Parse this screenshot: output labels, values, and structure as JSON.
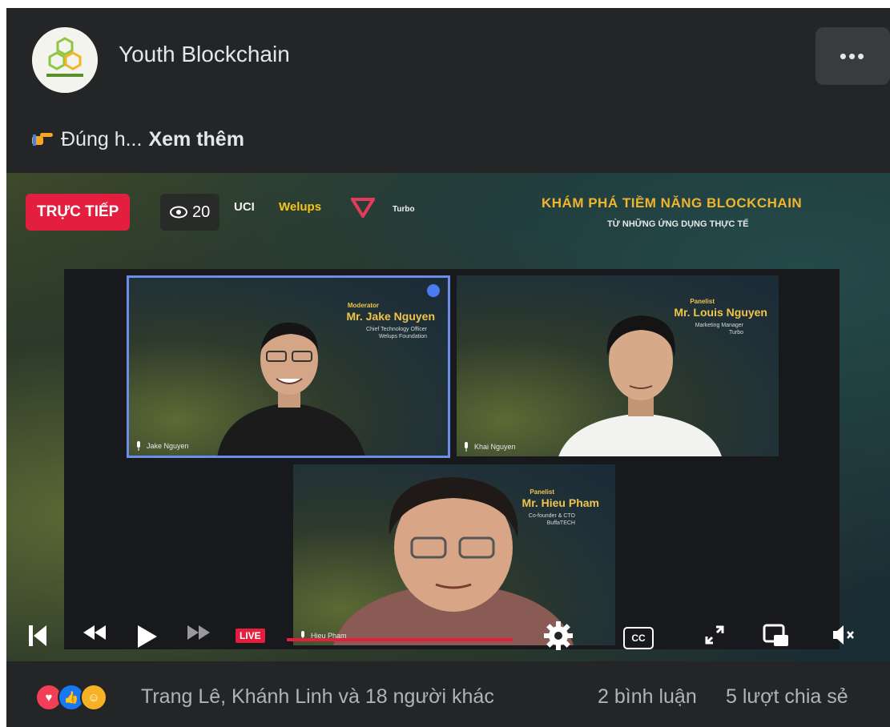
{
  "post": {
    "page_name": "Youth Blockchain",
    "more_label": "•••",
    "caption_text": "Đúng h...",
    "caption_more": "Xem thêm"
  },
  "video": {
    "live_label": "TRỰC TIẾP",
    "viewer_count": "20",
    "sponsors": [
      "UCI",
      "Welups",
      "Turbo"
    ],
    "banner_title": "KHÁM PHÁ TIỀM NĂNG BLOCKCHAIN",
    "banner_subtitle": "TỪ NHỮNG ỨNG DỤNG THỰC TẾ",
    "speakers": [
      {
        "role": "Moderator",
        "name": "Mr. Jake Nguyen",
        "title": "Chief Technology Officer\nWelups Foundation",
        "nameplate": "Jake Nguyen"
      },
      {
        "role": "Panelist",
        "name": "Mr. Louis Nguyen",
        "title": "Marketing Manager\nTurbo",
        "nameplate": "Khai Nguyen"
      },
      {
        "role": "Panelist",
        "name": "Mr. Hieu Pham",
        "title": "Co-founder & CTO\nBuffaTECH",
        "nameplate": "Hieu Pham"
      }
    ],
    "controls": {
      "live_tag": "LIVE",
      "cc_label": "CC",
      "progress": 1.0
    }
  },
  "footer": {
    "reaction_names": "Trang Lê, Khánh Linh và 18 người khác",
    "comment_count": "2 bình luận",
    "share_count": "5 lượt chia sẻ"
  },
  "colors": {
    "background": "#242526",
    "live_red": "#e41e3f",
    "banner_gold": "#f0b52c",
    "like_blue": "#1877f2"
  },
  "icons": [
    "more-icon",
    "pointing-hand-icon",
    "eye-icon",
    "skip-back-icon",
    "rewind-icon",
    "play-icon",
    "fast-forward-icon",
    "settings-gear-icon",
    "cc-icon",
    "fullscreen-icon",
    "picture-in-picture-icon",
    "mute-icon",
    "love-reaction-icon",
    "like-reaction-icon",
    "care-reaction-icon",
    "mic-icon"
  ]
}
